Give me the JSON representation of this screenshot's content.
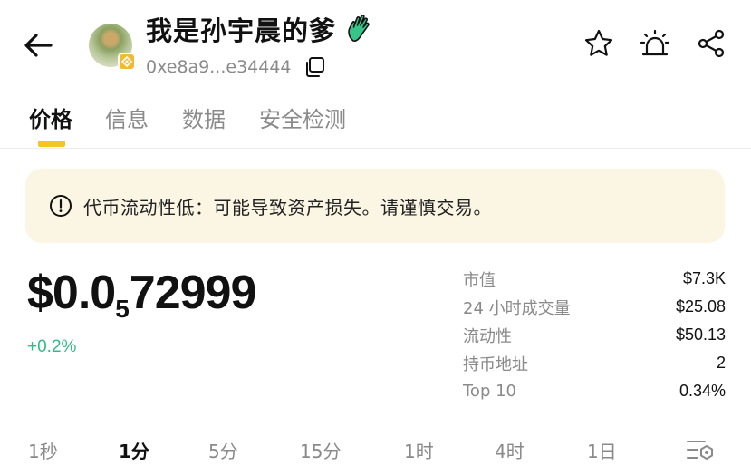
{
  "header": {
    "title": "我是孙宇晨的爹",
    "address": "0xe8a9...e34444",
    "icons": {
      "back": "back-arrow-icon",
      "title_emoji": "hand-icon",
      "copy": "copy-icon",
      "favorite": "star-icon",
      "alert": "alarm-icon",
      "share": "share-icon",
      "chain": "bnb-chain-icon"
    }
  },
  "tabs": [
    {
      "label": "价格",
      "active": true
    },
    {
      "label": "信息",
      "active": false
    },
    {
      "label": "数据",
      "active": false
    },
    {
      "label": "安全检测",
      "active": false
    }
  ],
  "warning": {
    "icon": "info-circle-icon",
    "text": "代币流动性低：可能导致资产损失。请谨慎交易。"
  },
  "price": {
    "prefix": "$0.0",
    "zero_count": "5",
    "digits": "72999",
    "change": "+0.2%"
  },
  "stats": [
    {
      "label": "市值",
      "value": "$7.3K"
    },
    {
      "label": "24 小时成交量",
      "value": "$25.08"
    },
    {
      "label": "流动性",
      "value": "$50.13"
    },
    {
      "label": "持币地址",
      "value": "2"
    },
    {
      "label": "Top 10",
      "value": "0.34%"
    }
  ],
  "intervals": [
    {
      "label": "1秒",
      "active": false
    },
    {
      "label": "1分",
      "active": true
    },
    {
      "label": "5分",
      "active": false
    },
    {
      "label": "15分",
      "active": false
    },
    {
      "label": "1时",
      "active": false
    },
    {
      "label": "4时",
      "active": false
    },
    {
      "label": "1日",
      "active": false
    }
  ],
  "colors": {
    "accent": "#f3c623",
    "positive": "#2fbd84",
    "warning_bg": "#fbf6e3",
    "muted": "#8a8a8a"
  }
}
